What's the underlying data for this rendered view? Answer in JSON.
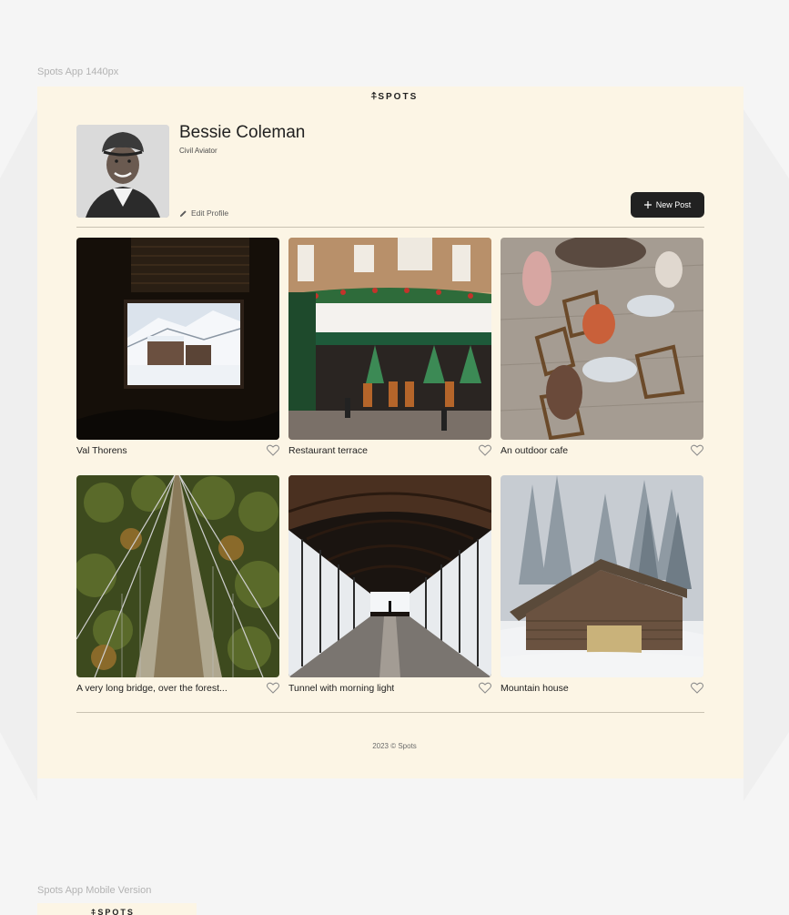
{
  "canvas": {
    "desktop_frame_label": "Spots App 1440px",
    "mobile_frame_label": "Spots App Mobile Version"
  },
  "header": {
    "logo_mark": "⍏",
    "logo_text": "SPOTS"
  },
  "profile": {
    "name": "Bessie Coleman",
    "role": "Civil Aviator",
    "edit_label": "Edit Profile",
    "new_post_label": "New Post",
    "edit_icon": "pencil-icon",
    "new_post_icon": "plus-icon"
  },
  "cards": [
    {
      "title": "Val Thorens",
      "liked": false
    },
    {
      "title": "Restaurant terrace",
      "liked": false
    },
    {
      "title": "An outdoor cafe",
      "liked": false
    },
    {
      "title": "A very long bridge, over the forest...",
      "liked": false
    },
    {
      "title": "Tunnel with morning light",
      "liked": false
    },
    {
      "title": "Mountain house",
      "liked": false
    }
  ],
  "footer": {
    "text": "2023 © Spots"
  },
  "mobile": {
    "logo_mark": "⍏",
    "logo_text": "SPOTS"
  },
  "colors": {
    "page_bg": "#f5f5f5",
    "frame_bg": "#fcf5e5",
    "text": "#212121",
    "button_bg": "#212121",
    "button_text": "#ffffff"
  }
}
